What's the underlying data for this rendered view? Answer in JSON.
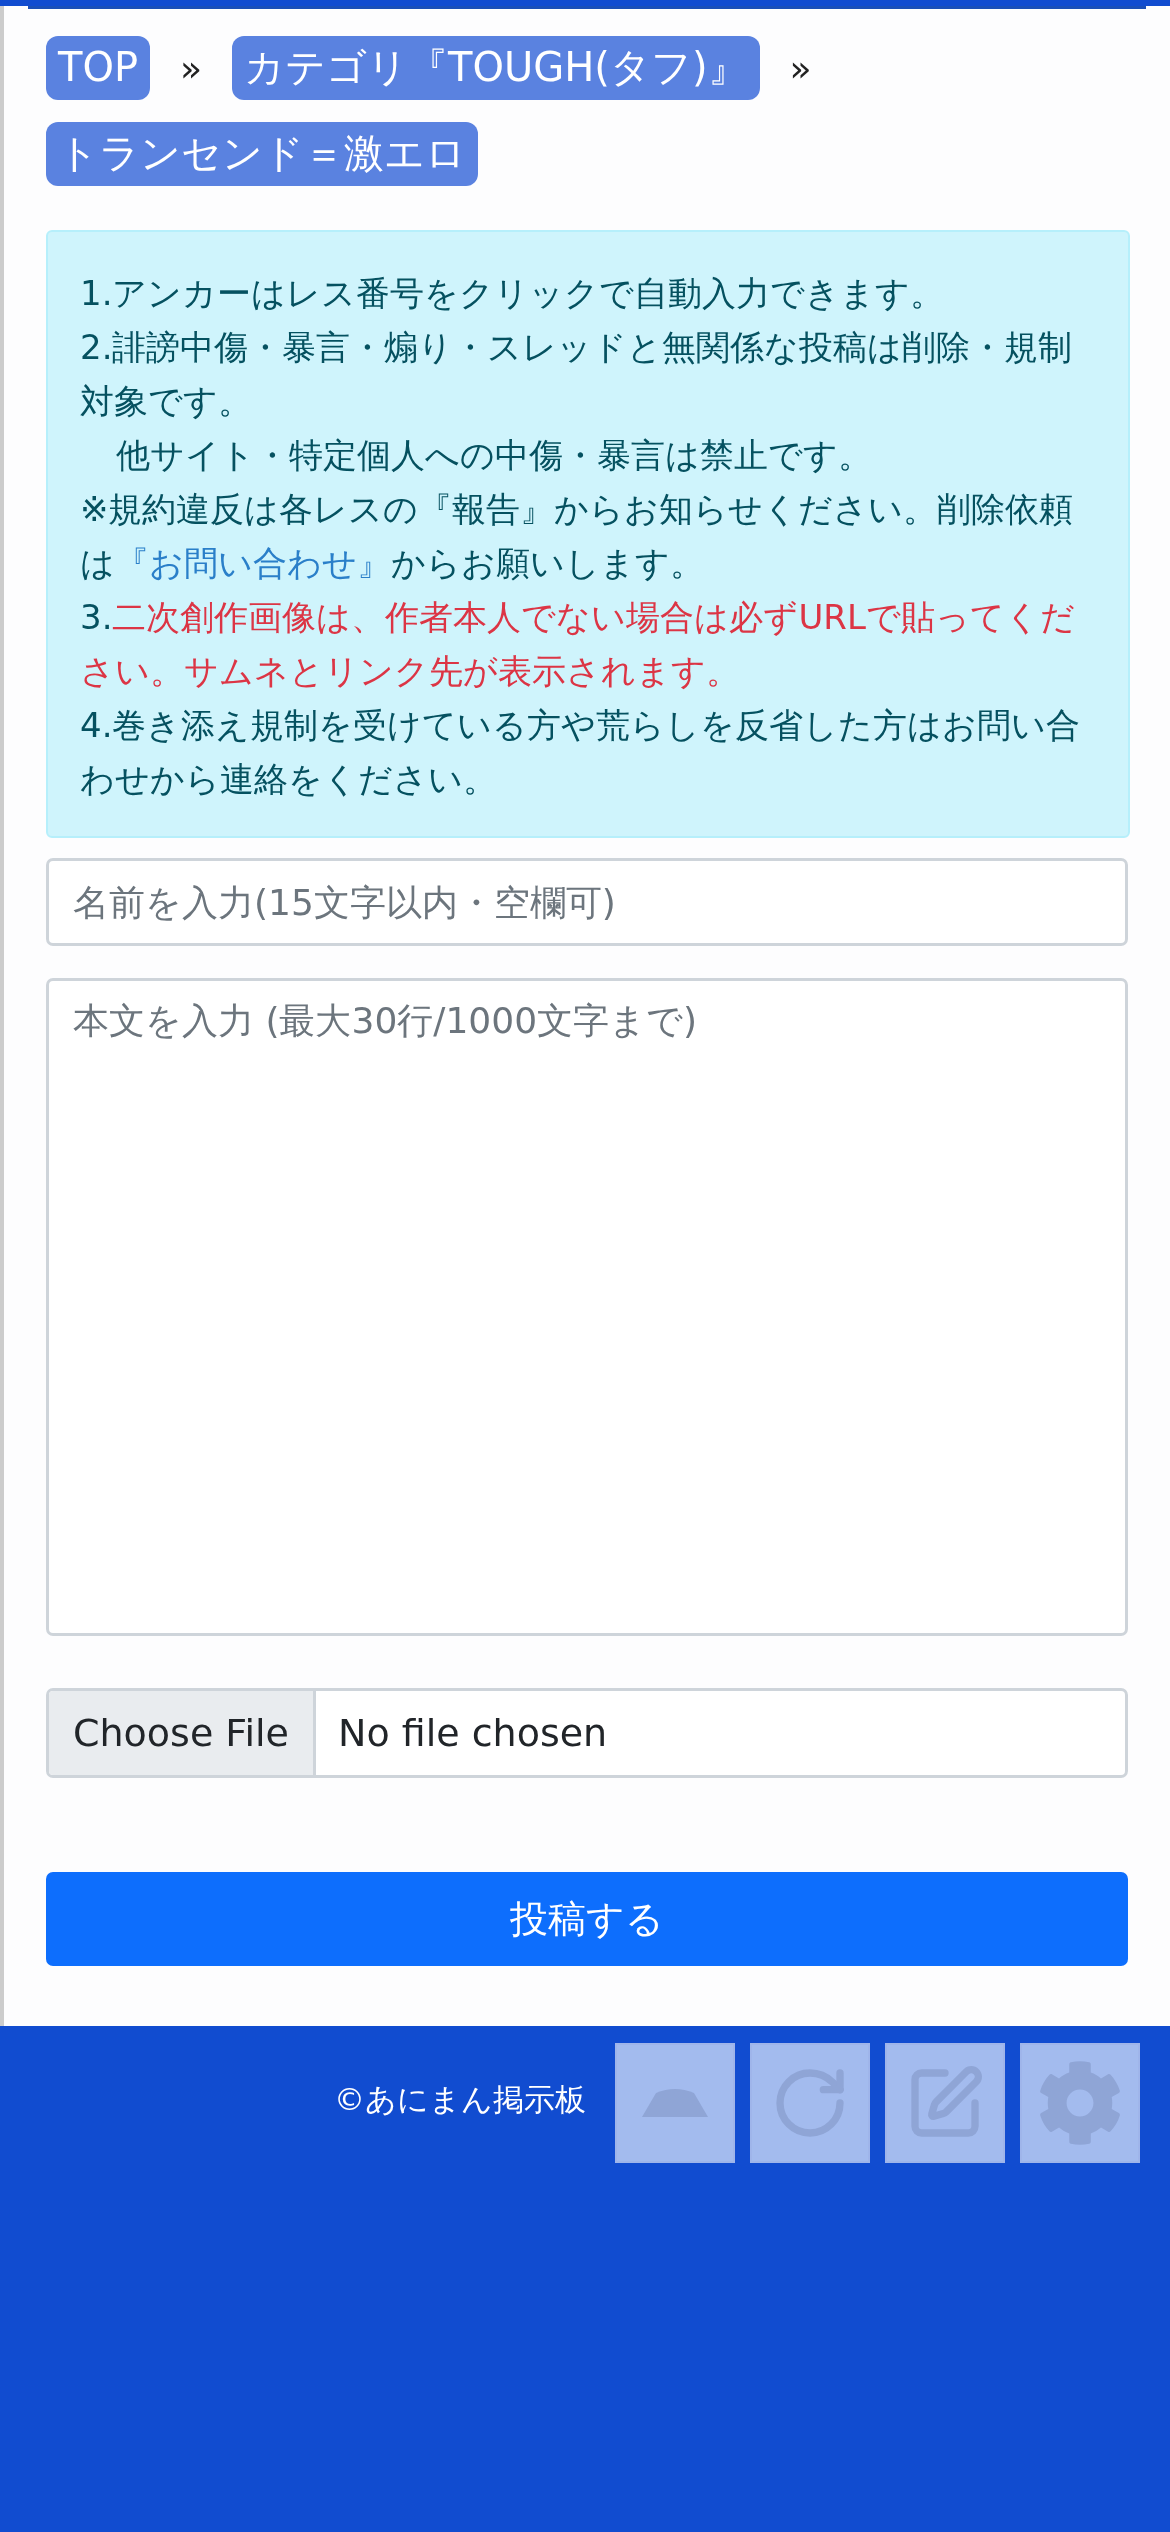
{
  "breadcrumbs": [
    {
      "label": "TOP"
    },
    {
      "label": "カテゴリ『TOUGH(タフ)』"
    },
    {
      "label": "トランセンド＝激エロ"
    }
  ],
  "breadcrumb_separator": "»",
  "notice": {
    "lines": [
      {
        "kind": "plain",
        "text": "1.アンカーはレス番号をクリックで自動入力できます。"
      },
      {
        "kind": "plain",
        "text": "2.誹謗中傷・暴言・煽り・スレッドと無関係な投稿は削除・規制対象です。"
      },
      {
        "kind": "indent",
        "text": "他サイト・特定個人への中傷・暴言は禁止です。"
      },
      {
        "kind": "link",
        "before": "※規約違反は各レスの『報告』からお知らせください。削除依頼は",
        "link": "『お問い合わせ』",
        "after": "からお願いします。"
      },
      {
        "kind": "alert",
        "number": "3.",
        "text": "二次創作画像は、作者本人でない場合は必ずURLで貼ってください。サムネとリンク先が表示されます。"
      },
      {
        "kind": "plain",
        "text": "4.巻き添え規制を受けている方や荒らしを反省した方はお問い合わせから連絡をください。"
      }
    ]
  },
  "form": {
    "name_placeholder": "名前を入力(15文字以内・空欄可)",
    "body_placeholder": "本文を入力 (最大30行/1000文字まで)",
    "file_button": "Choose File",
    "file_status": "No file chosen",
    "submit": "投稿する"
  },
  "footer": {
    "copyright": "©あにまん掲示板"
  }
}
